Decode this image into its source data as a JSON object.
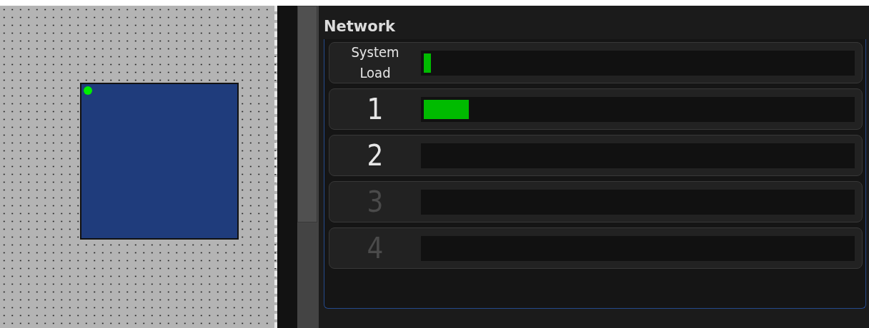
{
  "panel": {
    "title": "Network"
  },
  "rows": [
    {
      "kind": "summary",
      "label": "System Load",
      "disabled": false,
      "level": 0.017
    },
    {
      "kind": "port",
      "label": "1",
      "disabled": false,
      "level": 0.104
    },
    {
      "kind": "port",
      "label": "2",
      "disabled": false
    },
    {
      "kind": "port",
      "label": "3",
      "disabled": true
    },
    {
      "kind": "port",
      "label": "4",
      "disabled": true
    }
  ]
}
